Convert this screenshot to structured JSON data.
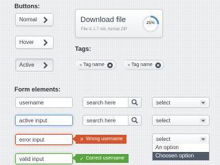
{
  "buttons": {
    "heading": "Buttons:",
    "normal": "Normal",
    "hover": "Hover",
    "active": "Active"
  },
  "download": {
    "title": "Download file",
    "subtitle": "File is 1.7 mb, format ZIP",
    "progress_text": "25%",
    "progress": 0.25
  },
  "tags": {
    "heading": "Tags:",
    "items": [
      {
        "label": "Tag name",
        "icon": "plus-icon"
      },
      {
        "label": "Tag name",
        "icon": "close-icon"
      }
    ]
  },
  "form": {
    "heading": "Form elements:",
    "username_value": "username",
    "active_value": "active input",
    "error_value": "error input",
    "valid_value": "valid input",
    "search1": "search here",
    "search2": "search here",
    "select1": "select",
    "select2": "select",
    "select3": "select",
    "error_msg": "Wrong username",
    "ok_msg": "Correct username",
    "dropdown_options": [
      "An option",
      "Choosen option"
    ]
  },
  "colors": {
    "accent_blue": "#4a90c8",
    "error": "#d9542b",
    "success": "#5aa43d",
    "selected_option": "#4f5b6a"
  }
}
